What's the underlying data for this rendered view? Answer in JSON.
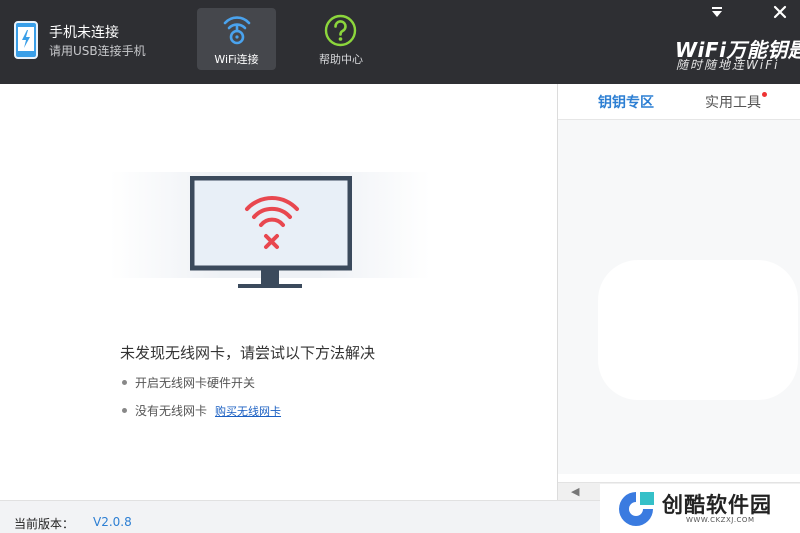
{
  "header": {
    "device_status": "手机未连接",
    "device_hint": "请用USB连接手机",
    "nav": [
      {
        "label": "WiFi连接",
        "icon": "wifi-key-icon",
        "active": true
      },
      {
        "label": "帮助中心",
        "icon": "help-circle-icon",
        "active": false
      }
    ],
    "window_controls": [
      "menu-arrow-icon",
      "close-icon"
    ],
    "brand": {
      "name": "WiFi万能钥匙",
      "slogan": "随时随地连WiFi"
    }
  },
  "main": {
    "illustration": "monitor-wifi-error-icon",
    "error_title": "未发现无线网卡，请尝试以下方法解决",
    "tips": [
      {
        "text": "开启无线网卡硬件开关"
      },
      {
        "text": "没有无线网卡",
        "link": "购买无线网卡"
      }
    ]
  },
  "sidebar": {
    "tabs": [
      {
        "label": "钥钥专区",
        "active": true
      },
      {
        "label": "实用工具",
        "active": false,
        "badge_dot": true
      }
    ]
  },
  "status_bar": {
    "version_label": "当前版本：",
    "version_value": "V2.0.8"
  },
  "watermark": {
    "name": "创酷软件园",
    "url": "WWW.CKZXJ.COM"
  },
  "colors": {
    "header_bg": "#2e2f33",
    "accent_blue": "#2d7fd3",
    "error_red": "#e8474f",
    "help_green": "#8cd63c",
    "monitor_dark": "#3b4a5c",
    "monitor_screen": "#e8eff7"
  }
}
